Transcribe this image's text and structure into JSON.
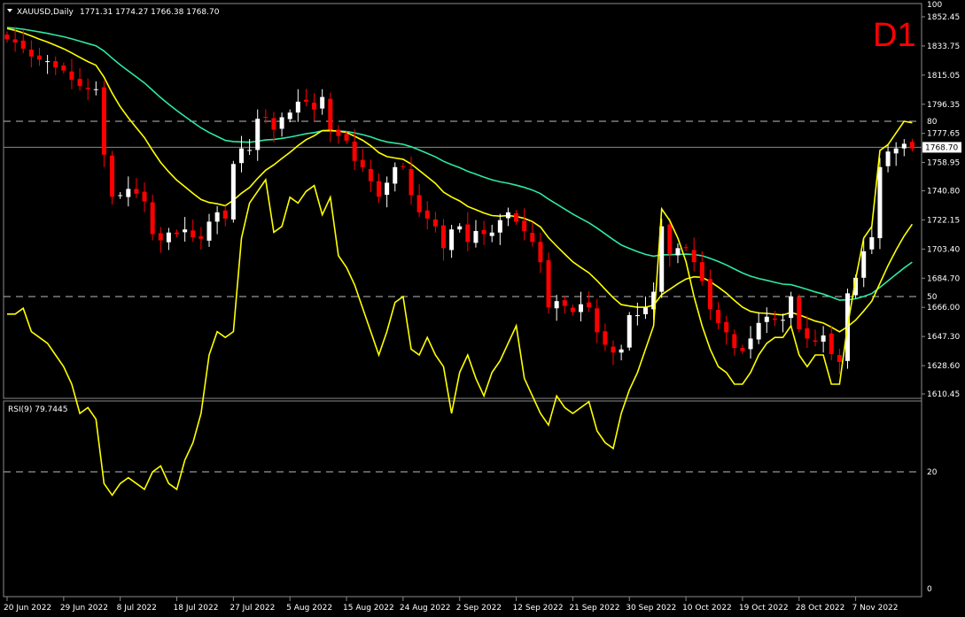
{
  "window": {
    "title": "XAUUSD,Daily",
    "ohlc": "1771.31 1774.27 1766.38 1768.70",
    "timeframe": "D1"
  },
  "chart_data": [
    {
      "type": "candlestick",
      "title": "XAUUSD,Daily",
      "price_ticks": [
        "1852.45",
        "1833.75",
        "1815.05",
        "1796.35",
        "1777.65",
        "1758.95",
        "1740.80",
        "1722.15",
        "1703.40",
        "1684.70",
        "1666.00",
        "1647.30",
        "1628.60",
        "1610.45"
      ],
      "current_price": "1768.70",
      "ylim": [
        1607,
        1858
      ],
      "x_tick_labels": [
        "20 Jun 2022",
        "29 Jun 2022",
        "8 Jul 2022",
        "18 Jul 2022",
        "27 Jul 2022",
        "5 Aug 2022",
        "15 Aug 2022",
        "24 Aug 2022",
        "2 Sep 2022",
        "12 Sep 2022",
        "21 Sep 2022",
        "30 Sep 2022",
        "10 Oct 2022",
        "19 Oct 2022",
        "28 Oct 2022",
        "7 Nov 2022"
      ],
      "x_tick_indices": [
        0,
        7,
        14,
        21,
        28,
        35,
        42,
        49,
        56,
        63,
        70,
        77,
        84,
        91,
        98,
        105
      ],
      "colors": {
        "bull": "#ffffff",
        "bear": "#ff0000",
        "ma_fast": "#ffff00",
        "ma_slow": "#2ee8a2",
        "price_line": "#8a8a8a"
      },
      "closes": [
        1838,
        1836,
        1832,
        1827,
        1825,
        1824,
        1820,
        1818,
        1812,
        1808,
        1806,
        1806,
        1764,
        1737,
        1738,
        1742,
        1739,
        1734,
        1713,
        1709,
        1714,
        1713,
        1716,
        1711,
        1710,
        1721,
        1727,
        1723,
        1758,
        1768,
        1767,
        1787,
        1788,
        1780,
        1788,
        1791,
        1798,
        1798,
        1793,
        1801,
        1780,
        1776,
        1773,
        1760,
        1756,
        1747,
        1737,
        1746,
        1756,
        1756,
        1738,
        1727,
        1723,
        1718,
        1704,
        1716,
        1718,
        1708,
        1715,
        1713,
        1714,
        1722,
        1727,
        1721,
        1715,
        1708,
        1695,
        1666,
        1670,
        1667,
        1663,
        1668,
        1666,
        1650,
        1642,
        1637,
        1639,
        1661,
        1661,
        1666,
        1676,
        1718,
        1700,
        1704,
        1704,
        1695,
        1683,
        1665,
        1656,
        1650,
        1640,
        1638,
        1646,
        1656,
        1660,
        1658,
        1658,
        1673,
        1652,
        1646,
        1644,
        1648,
        1636,
        1631,
        1675,
        1685,
        1702,
        1711,
        1756,
        1766,
        1768,
        1771,
        1768
      ]
    },
    {
      "type": "line",
      "title": "RSI(9) 79.7445",
      "ylim": [
        0,
        100
      ],
      "yticks": [
        "100",
        "80",
        "50",
        "20",
        "0"
      ],
      "levels": [
        80,
        50,
        20
      ],
      "values": [
        47,
        47,
        48,
        44,
        43,
        42,
        40,
        38,
        35,
        30,
        31,
        29,
        18,
        16,
        18,
        19,
        18,
        17,
        20,
        21,
        18,
        17,
        22,
        25,
        30,
        40,
        44,
        43,
        44,
        60,
        66,
        68,
        70,
        61,
        62,
        67,
        66,
        68,
        69,
        64,
        67,
        57,
        55,
        52,
        48,
        44,
        40,
        44,
        49,
        50,
        41,
        40,
        43,
        40,
        38,
        30,
        37,
        40,
        36,
        33,
        37,
        39,
        42,
        45,
        36,
        33,
        30,
        28,
        33,
        31,
        30,
        31,
        32,
        27,
        25,
        24,
        30,
        34,
        37,
        41,
        45,
        65,
        63,
        60,
        56,
        50,
        45,
        41,
        38,
        37,
        35,
        35,
        37,
        40,
        42,
        43,
        43,
        45,
        40,
        38,
        40,
        40,
        35,
        35,
        45,
        53,
        60,
        62,
        75,
        76,
        78,
        80,
        79.7445
      ]
    }
  ]
}
